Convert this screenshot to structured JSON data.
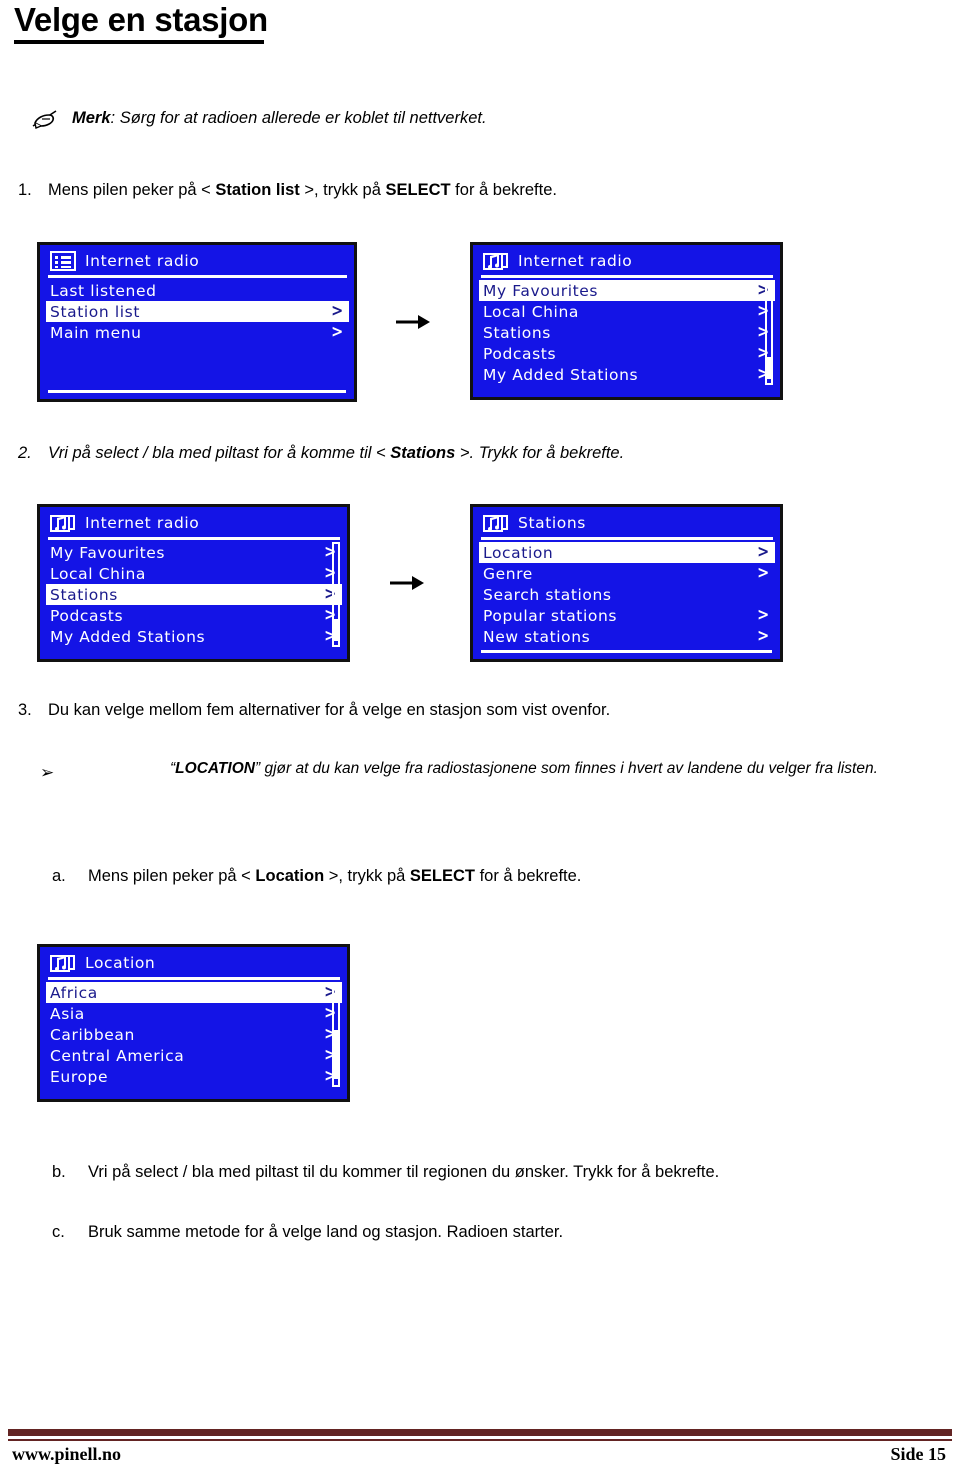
{
  "document": {
    "title": "Velge en stasjon",
    "note": {
      "icon": "pen-note-icon",
      "label": "Merk",
      "text": ": Sørg for at radioen allerede er koblet til nettverket."
    },
    "steps": [
      {
        "number": "1.",
        "pre": "Mens pilen peker på < ",
        "bold1": "Station list",
        "mid": " >, trykk på ",
        "bold2": "SELECT",
        "post": " for å bekrefte."
      },
      {
        "number": "2.",
        "pre": "Vri på select / bla med piltast for å komme til < ",
        "bold1": "Stations",
        "mid": " >. Trykk for å bekrefte.",
        "bold2": "",
        "post": ""
      },
      {
        "number": "3.",
        "pre": "Du kan velge mellom fem alternativer for å velge en stasjon som vist ovenfor.",
        "bold1": "",
        "mid": "",
        "bold2": "",
        "post": ""
      }
    ],
    "bullet": {
      "marker": "➢",
      "quote_open": "“",
      "keyword": "LOCATION",
      "quote_close": "”",
      "text": " gjør at du kan velge fra radiostasjonene som finnes i hvert av landene du velger fra listen."
    },
    "substeps": [
      {
        "letter": "a.",
        "pre": "Mens pilen peker på < ",
        "bold1": "Location",
        "mid": " >, trykk på ",
        "bold2": "SELECT",
        "post": " for å bekrefte."
      },
      {
        "letter": "b.",
        "pre": "Vri på select / bla med piltast til du kommer til regionen du ønsker. Trykk for å bekrefte.",
        "bold1": "",
        "mid": "",
        "bold2": "",
        "post": ""
      },
      {
        "letter": "c.",
        "pre": "Bruk samme metode for å velge land og stasjon. Radioen starter.",
        "bold1": "",
        "mid": "",
        "bold2": "",
        "post": ""
      }
    ],
    "footer": {
      "left": "www.pinell.no",
      "right": "Side 15",
      "bar_color": "#632423"
    },
    "colors": {
      "lcd_background": "#1414e6",
      "lcd_text": "#ffffff",
      "lcd_selected_background": "#ffffff",
      "lcd_selected_text": "#1a1a8c",
      "lcd_border": "#111111"
    }
  },
  "screens": [
    {
      "id": "screen1",
      "icon": "list-icon",
      "header": "Internet radio",
      "has_scrollbar": false,
      "has_bottom_rule": true,
      "rows": [
        {
          "label": "Last listened",
          "chevron": false,
          "selected": false
        },
        {
          "label": "Station list",
          "chevron": true,
          "selected": true
        },
        {
          "label": "Main menu",
          "chevron": true,
          "selected": false
        }
      ]
    },
    {
      "id": "screen2",
      "icon": "music-note-icon",
      "header": "Internet radio",
      "has_scrollbar": true,
      "scroll_thumb_top": "74%",
      "scroll_thumb_height": "22%",
      "has_bottom_rule": false,
      "rows": [
        {
          "label": "My Favourites",
          "chevron": true,
          "selected": true
        },
        {
          "label": "Local China",
          "chevron": true,
          "selected": false
        },
        {
          "label": "Stations",
          "chevron": true,
          "selected": false
        },
        {
          "label": "Podcasts",
          "chevron": true,
          "selected": false
        },
        {
          "label": "My Added Stations",
          "chevron": true,
          "selected": false
        }
      ]
    },
    {
      "id": "screen3",
      "icon": "music-note-icon",
      "header": "Internet radio",
      "has_scrollbar": true,
      "scroll_thumb_top": "74%",
      "scroll_thumb_height": "22%",
      "has_bottom_rule": false,
      "rows": [
        {
          "label": "My Favourites",
          "chevron": true,
          "selected": false
        },
        {
          "label": "Local China",
          "chevron": true,
          "selected": false
        },
        {
          "label": "Stations",
          "chevron": true,
          "selected": true
        },
        {
          "label": "Podcasts",
          "chevron": true,
          "selected": false
        },
        {
          "label": "My Added Stations",
          "chevron": true,
          "selected": false
        }
      ]
    },
    {
      "id": "screen4",
      "icon": "music-note-icon",
      "header": "Stations",
      "has_scrollbar": false,
      "has_bottom_rule": true,
      "rows": [
        {
          "label": "Location",
          "chevron": true,
          "selected": true
        },
        {
          "label": "Genre",
          "chevron": true,
          "selected": false
        },
        {
          "label": "Search stations",
          "chevron": false,
          "selected": false
        },
        {
          "label": "Popular stations",
          "chevron": true,
          "selected": false
        },
        {
          "label": "New stations",
          "chevron": true,
          "selected": false
        }
      ]
    },
    {
      "id": "screen5",
      "icon": "music-note-icon",
      "header": "Location",
      "has_scrollbar": true,
      "scroll_thumb_top": "46%",
      "scroll_thumb_height": "48%",
      "has_bottom_rule": false,
      "rows": [
        {
          "label": "Africa",
          "chevron": true,
          "selected": true
        },
        {
          "label": "Asia",
          "chevron": true,
          "selected": false
        },
        {
          "label": "Caribbean",
          "chevron": true,
          "selected": false
        },
        {
          "label": "Central America",
          "chevron": true,
          "selected": false
        },
        {
          "label": "Europe",
          "chevron": true,
          "selected": false
        }
      ]
    }
  ],
  "flow_arrows": [
    {
      "id": "arrow1",
      "name": "flow-arrow-right"
    },
    {
      "id": "arrow2",
      "name": "flow-arrow-right"
    }
  ]
}
